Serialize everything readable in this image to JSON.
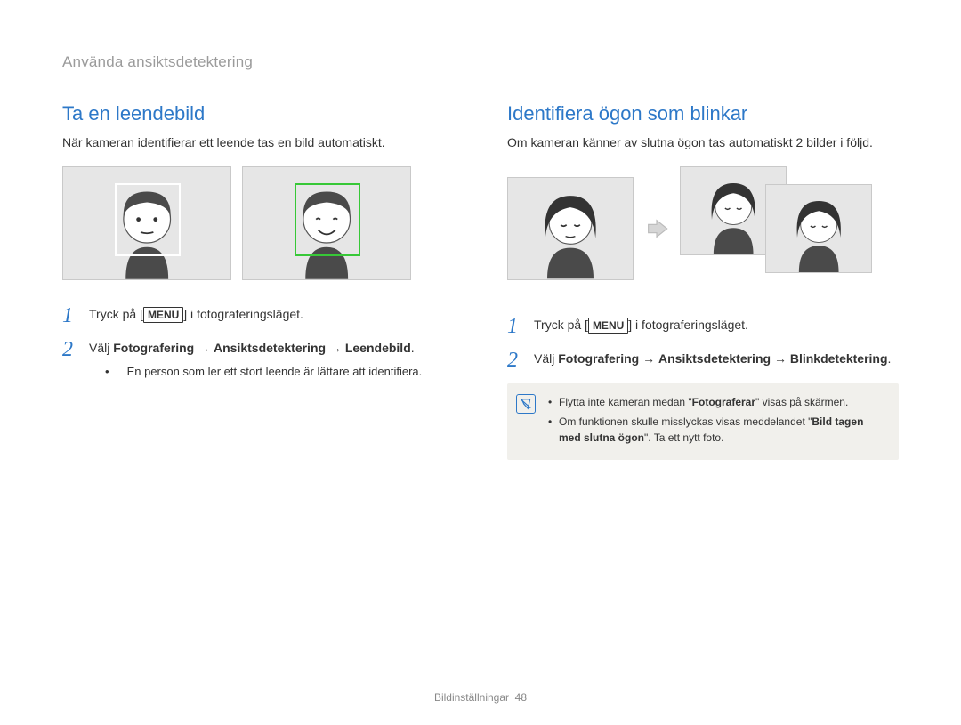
{
  "breadcrumb": "Använda ansiktsdetektering",
  "left": {
    "title": "Ta en leendebild",
    "desc": "När kameran identifierar ett leende tas en bild automatiskt.",
    "step1_pre": "Tryck på [",
    "step1_menu": "MENU",
    "step1_post": "] i fotograferingsläget.",
    "step2_pre": "Välj ",
    "step2_b1": "Fotografering",
    "step2_arrow": " → ",
    "step2_b2": "Ansiktsdetektering",
    "step2_b3": "Leendebild",
    "step2_period": ".",
    "bullet1": "En person som ler ett stort leende är lättare att identifiera."
  },
  "right": {
    "title": "Identifiera ögon som blinkar",
    "desc": "Om kameran känner av slutna ögon tas automatiskt 2 bilder i följd.",
    "step1_pre": "Tryck på [",
    "step1_menu": "MENU",
    "step1_post": "] i fotograferingsläget.",
    "step2_pre": "Välj ",
    "step2_b1": "Fotografering",
    "step2_arrow": " → ",
    "step2_b2": "Ansiktsdetektering",
    "step2_b3": "Blinkdetektering",
    "step2_period": ".",
    "note1_pre": "Flytta inte kameran medan \"",
    "note1_b": "Fotograferar",
    "note1_post": "\" visas på skärmen.",
    "note2_pre": "Om funktionen skulle misslyckas visas meddelandet \"",
    "note2_b": "Bild tagen med slutna ögon",
    "note2_post": "\". Ta ett nytt foto."
  },
  "step_numbers": {
    "one": "1",
    "two": "2"
  },
  "footer": {
    "section": "Bildinställningar",
    "page": "48"
  }
}
